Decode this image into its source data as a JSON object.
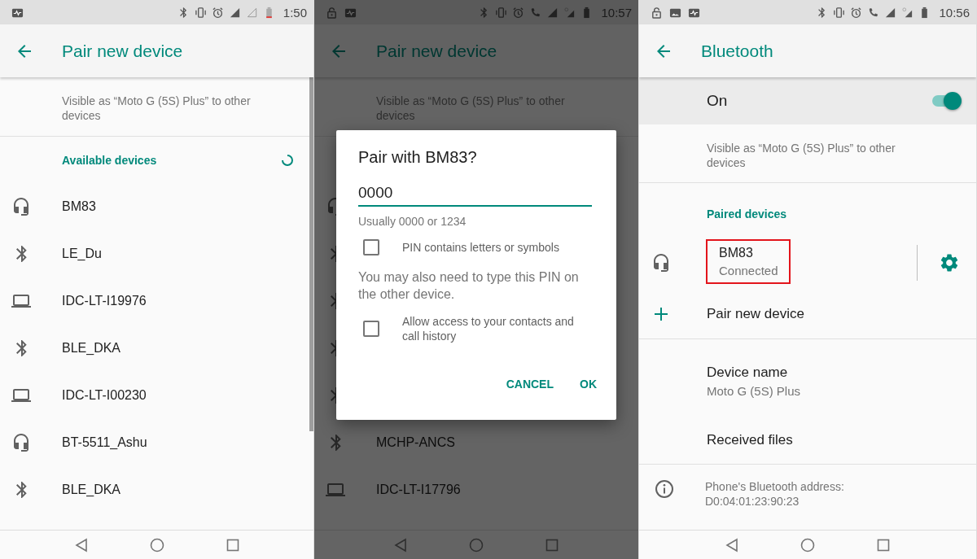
{
  "panels": [
    {
      "kind": "pair",
      "status_bar": {
        "left_icons": [
          {
            "kind": "activity"
          }
        ],
        "right_icons": [
          {
            "kind": "bluetooth"
          },
          {
            "kind": "vibrate"
          },
          {
            "kind": "alarm"
          },
          {
            "kind": "signal"
          },
          {
            "kind": "signal-empty"
          },
          {
            "kind": "battery-low"
          }
        ],
        "time": "1:50"
      },
      "app_bar": {
        "title": "Pair new device"
      },
      "visible_text": "Visible as “Moto G (5S) Plus” to other devices",
      "section_header": "Available devices",
      "scanning": true,
      "devices": [
        {
          "kind": "headphones",
          "name": "BM83"
        },
        {
          "kind": "bluetooth",
          "name": "LE_Du"
        },
        {
          "kind": "laptop",
          "name": "IDC-LT-I19976"
        },
        {
          "kind": "bluetooth",
          "name": "BLE_DKA"
        },
        {
          "kind": "laptop",
          "name": "IDC-LT-I00230"
        },
        {
          "kind": "headphones",
          "name": "BT-5511_Ashu"
        },
        {
          "kind": "bluetooth",
          "name": "BLE_DKA"
        }
      ]
    },
    {
      "kind": "pair",
      "dimmed": true,
      "status_bar": {
        "left_icons": [
          {
            "kind": "lock"
          },
          {
            "kind": "activity"
          }
        ],
        "right_icons": [
          {
            "kind": "bluetooth"
          },
          {
            "kind": "vibrate"
          },
          {
            "kind": "alarm"
          },
          {
            "kind": "call"
          },
          {
            "kind": "signal"
          },
          {
            "kind": "signal-lte"
          },
          {
            "kind": "battery"
          }
        ],
        "time": "10:57"
      },
      "app_bar": {
        "title": "Pair new device"
      },
      "visible_text": "Visible as “Moto G (5S) Plus” to other devices",
      "devices": [
        {
          "kind": "headphones"
        },
        {
          "kind": "bluetooth"
        },
        {
          "kind": "bluetooth"
        },
        {
          "kind": "bluetooth"
        },
        {
          "kind": "bluetooth"
        },
        {
          "kind": "bluetooth",
          "name": "MCHP-ANCS"
        },
        {
          "kind": "laptop",
          "name": "IDC-LT-I17796"
        }
      ],
      "dialog": {
        "title": "Pair with BM83?",
        "pin_value": "0000",
        "hint": "Usually 0000 or 1234",
        "options": [
          {
            "label": "PIN contains letters or symbols",
            "checked": false
          }
        ],
        "note": "You may also need to type this PIN on the other device.",
        "options_2": [
          {
            "label": "Allow access to your contacts and call history",
            "checked": false
          }
        ],
        "buttons": [
          "CANCEL",
          "OK"
        ]
      }
    },
    {
      "kind": "bluetooth",
      "status_bar": {
        "left_icons": [
          {
            "kind": "lock"
          },
          {
            "kind": "image"
          },
          {
            "kind": "activity"
          }
        ],
        "right_icons": [
          {
            "kind": "bluetooth"
          },
          {
            "kind": "vibrate"
          },
          {
            "kind": "alarm"
          },
          {
            "kind": "call"
          },
          {
            "kind": "signal"
          },
          {
            "kind": "signal-lte"
          },
          {
            "kind": "battery"
          }
        ],
        "time": "10:56"
      },
      "app_bar": {
        "title": "Bluetooth"
      },
      "switch": {
        "label": "On",
        "on": true
      },
      "visible_text": "Visible as “Moto G (5S) Plus” to other devices",
      "section_header": "Paired devices",
      "paired": [
        {
          "kind": "headphones",
          "name": "BM83",
          "status": "Connected",
          "highlighted": true
        }
      ],
      "pair_new": "Pair new device",
      "settings": [
        {
          "title": "Device name",
          "subtitle": "Moto G (5S) Plus"
        },
        {
          "title": "Received files"
        }
      ],
      "footer": "Phone's Bluetooth address: D0:04:01:23:90:23"
    }
  ]
}
